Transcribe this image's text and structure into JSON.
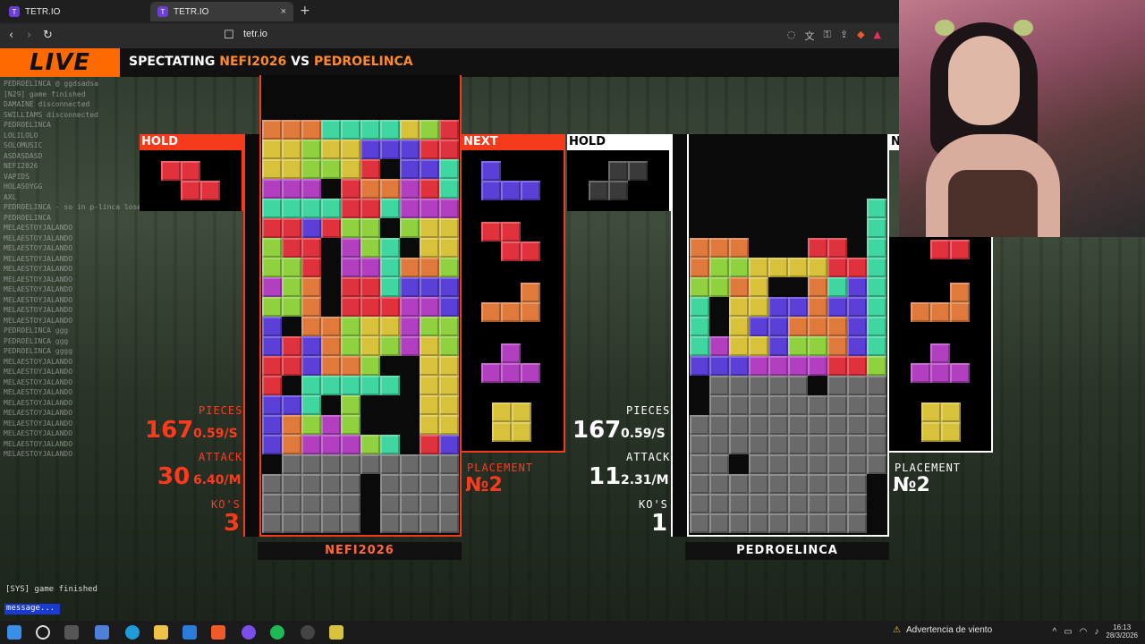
{
  "browser": {
    "tabs": [
      {
        "label": "TETR.IO"
      },
      {
        "label": "TETR.IO"
      }
    ],
    "url": "tetr.io",
    "new_tab": "+",
    "close": "×"
  },
  "header": {
    "live": "LIVE",
    "spectating": "SPECTATING",
    "player1": "NEFI2026",
    "vs": "VS",
    "player2": "PEDROELINCA"
  },
  "chat": {
    "lines": [
      "PEDROELINCA @ ggdsadsa",
      "[N29] game finished",
      "DAMAINE disconnected",
      "SWILLIAMS disconnected",
      "PEDROELINCA",
      "LOLILOLO",
      "SOLOMUSIC",
      "ASDASDASD",
      "NEFI2026",
      "VAPIDS",
      "HOLASOYGG",
      "AXL",
      "PEDROELINCA - so in p-linca loses",
      "PEDROELINCA",
      "MELAESTOYJALANDO",
      "MELAESTOYJALANDO",
      "MELAESTOYJALANDO",
      "MELAESTOYJALANDO",
      "MELAESTOYJALANDO",
      "MELAESTOYJALANDO",
      "MELAESTOYJALANDO",
      "MELAESTOYJALANDO",
      "MELAESTOYJALANDO",
      "MELAESTOYJALANDO",
      "PEDROELINCA ggg",
      "PEDROELINCA ggg",
      "PEDROELINCA gggg",
      "MELAESTOYJALANDO",
      "MELAESTOYJALANDO",
      "MELAESTOYJALANDO",
      "MELAESTOYJALANDO",
      "MELAESTOYJALANDO",
      "MELAESTOYJALANDO",
      "MELAESTOYJALANDO",
      "MELAESTOYJALANDO",
      "MELAESTOYJALANDO",
      "MELAESTOYJALANDO"
    ],
    "sys": "[SYS] game finished",
    "input_placeholder": "message..."
  },
  "left_player": {
    "hold_label": "HOLD",
    "next_label": "NEXT",
    "name": "NEFI2026",
    "pieces_label": "PIECES",
    "pieces": "167",
    "pieces_rate": "0.59/S",
    "attack_label": "ATTACK",
    "attack": "30",
    "attack_rate": "6.40/M",
    "kos_label": "KO'S",
    "kos": "3",
    "placement_label": "PLACEMENT",
    "placement": "№2"
  },
  "right_player": {
    "hold_label": "HOLD",
    "next_label": "N",
    "name": "PEDROELINCA",
    "pieces_label": "PIECES",
    "pieces": "167",
    "pieces_rate": "0.59/S",
    "attack_label": "ATTACK",
    "attack": "11",
    "attack_rate": "2.31/M",
    "kos_label": "KO'S",
    "kos": "1",
    "placement_label": "PLACEMENT",
    "placement": "№2"
  },
  "colors": {
    "Z": "#e0323c",
    "S": "#8fd13f",
    "L": "#e07a3c",
    "J": "#5b3fd6",
    "T": "#b23fc0",
    "O": "#d8c23c",
    "I": "#3fd6a0",
    "G": "#6a6a6a",
    "E": "#0a0a0a"
  },
  "left_board": [
    "LLLIIIIOSZ",
    "OOSOOJJJZZ",
    "OOSSOZEJJI",
    "TTTEZLLTZI",
    "IIIIZZITTT",
    "ZZJZSSESOO",
    "SZZETSIEOO",
    "SSZETTILLS",
    "TSLEZZIJJJ",
    "SSLEZZZTTJ",
    "JELLSOOTSS",
    "JZJLSOSTOS",
    "ZZJLLSEEOO",
    "ZEIIIIIEOO",
    "JJIESEEEOO",
    "JLSTSEEEOO",
    "JLTTTSIEZJ",
    "EGGGGGGGGG",
    "GGGGGEGGGG",
    "GGGGGEGGGG",
    "GGGGGEGGGG"
  ],
  "right_board": [
    "EEEEEEEEEE",
    "EEEEEEEEEE",
    "EEEEEEEEEI",
    "EEEEEEEEEI",
    "LLLEEEZZEI",
    "LSSOOOOZZI",
    "SSLOEELIJI",
    "IEOOJJLJJI",
    "IEOJJLLLJI",
    "ITOOJSSLJI",
    "JJJTTTTZZS",
    "EGGGGGEGGG",
    "EGGGGGGGGG",
    "GGGGGGGGGG",
    "GGGGGGGGGG",
    "GGEGGGGGGG",
    "GGGGGGGGGE",
    "GGGGGGGGGE",
    "GGGGGGGGGE"
  ],
  "taskbar": {
    "weather": "Advertencia de viento",
    "time": "16:13",
    "date": "28/3/2026"
  }
}
